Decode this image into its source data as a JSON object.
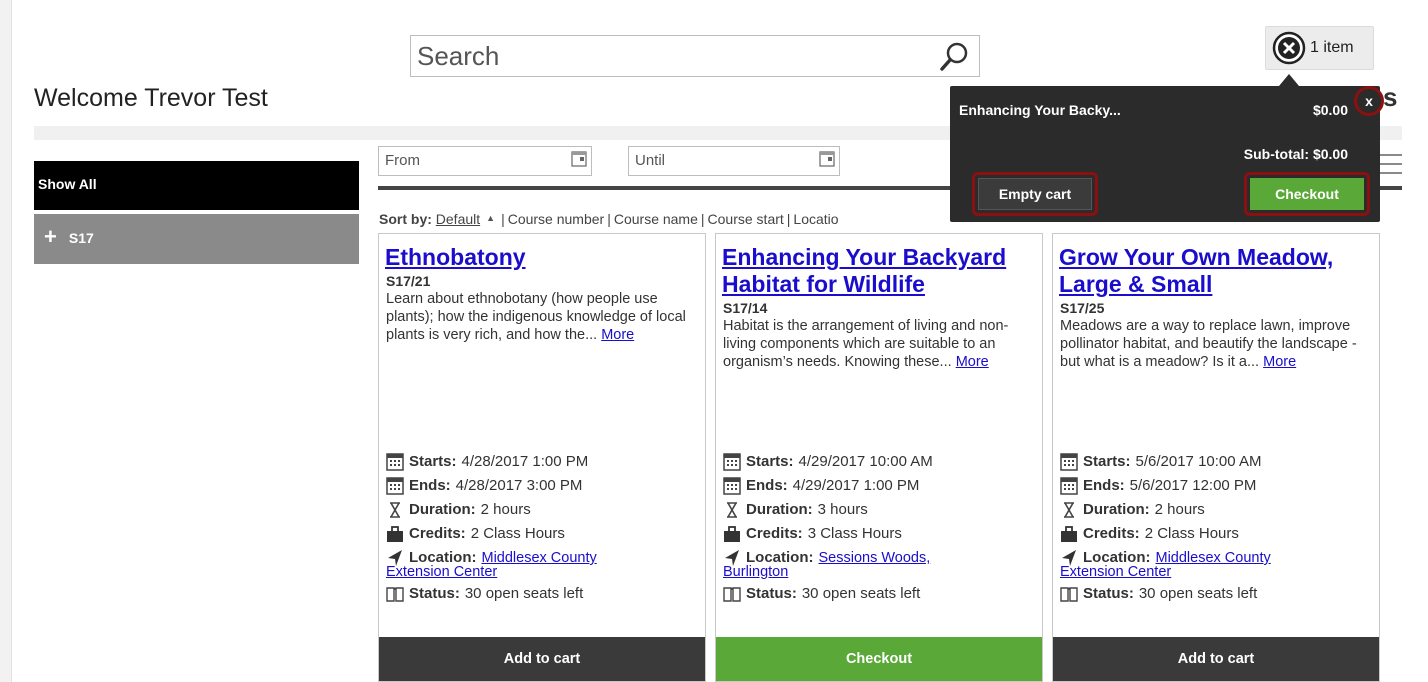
{
  "search": {
    "placeholder": "Search"
  },
  "welcome": "Welcome Trevor Test",
  "cart": {
    "count_label": "1 item",
    "item_name": "Enhancing Your Backy...",
    "item_price": "$0.00",
    "close_label": "x",
    "subtotal": "Sub-total: $0.00",
    "empty_label": "Empty cart",
    "checkout_label": "Checkout"
  },
  "header_partial": "s",
  "sidebar": {
    "items": [
      {
        "label": "Show All"
      },
      {
        "label": "S17",
        "icon": "plus"
      }
    ]
  },
  "filters": {
    "from_placeholder": "From",
    "until_placeholder": "Until"
  },
  "sort": {
    "label": "Sort by:",
    "current": "Default",
    "separator": "|",
    "options": [
      "Course number",
      "Course name",
      "Course start",
      "Locatio"
    ]
  },
  "courses": [
    {
      "title": "Ethnobatony",
      "code": "S17/21",
      "description": "Learn about ethnobotany (how people use plants); how the indigenous knowledge of local plants is very rich, and how the...",
      "more": "More",
      "starts_label": "Starts:",
      "starts": "4/28/2017 1:00 PM",
      "ends_label": "Ends:",
      "ends": "4/28/2017 3:00 PM",
      "duration_label": "Duration:",
      "duration": "2 hours",
      "credits_label": "Credits:",
      "credits": "2 Class Hours",
      "location_label": "Location:",
      "location_a": "Middlesex County",
      "location_b": "Extension Center",
      "status_label": "Status:",
      "status": "30 open seats left",
      "action": "Add to cart"
    },
    {
      "title": "Enhancing Your Backyard Habitat for Wildlife",
      "code": "S17/14",
      "description": "Habitat is the arrangement of living and non-living components which are suitable to an organism’s needs. Knowing these...",
      "more": "More",
      "starts_label": "Starts:",
      "starts": "4/29/2017 10:00 AM",
      "ends_label": "Ends:",
      "ends": "4/29/2017 1:00 PM",
      "duration_label": "Duration:",
      "duration": "3 hours",
      "credits_label": "Credits:",
      "credits": "3 Class Hours",
      "location_label": "Location:",
      "location_a": "Sessions Woods,",
      "location_b": "Burlington",
      "status_label": "Status:",
      "status": "30 open seats left",
      "action": "Checkout"
    },
    {
      "title": "Grow Your Own Meadow, Large & Small",
      "code": "S17/25",
      "description": "Meadows are a way to replace lawn, improve pollinator habitat, and beautify the landscape - but what is a meadow? Is it a...",
      "more": "More",
      "starts_label": "Starts:",
      "starts": "5/6/2017 10:00 AM",
      "ends_label": "Ends:",
      "ends": "5/6/2017 12:00 PM",
      "duration_label": "Duration:",
      "duration": "2 hours",
      "credits_label": "Credits:",
      "credits": "2 Class Hours",
      "location_label": "Location:",
      "location_a": "Middlesex County",
      "location_b": "Extension Center",
      "status_label": "Status:",
      "status": "30 open seats left",
      "action": "Add to cart"
    }
  ],
  "colors": {
    "link": "#1a0dcc",
    "sidebar_active": "#000000",
    "sidebar_item": "#8a8a8a",
    "button_dark": "#3a3a3a",
    "button_green": "#5aa838",
    "highlight_ring": "#8b1010"
  }
}
